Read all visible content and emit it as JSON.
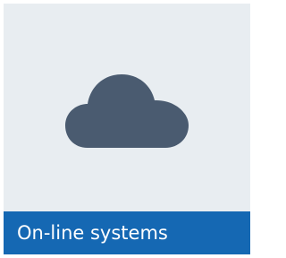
{
  "tile": {
    "title": "On-line systems",
    "icon": "cloud-icon",
    "colors": {
      "background": "#e8edf1",
      "icon": "#4a5b70",
      "caption_bar": "#1568b3",
      "caption_text": "#ffffff"
    }
  }
}
